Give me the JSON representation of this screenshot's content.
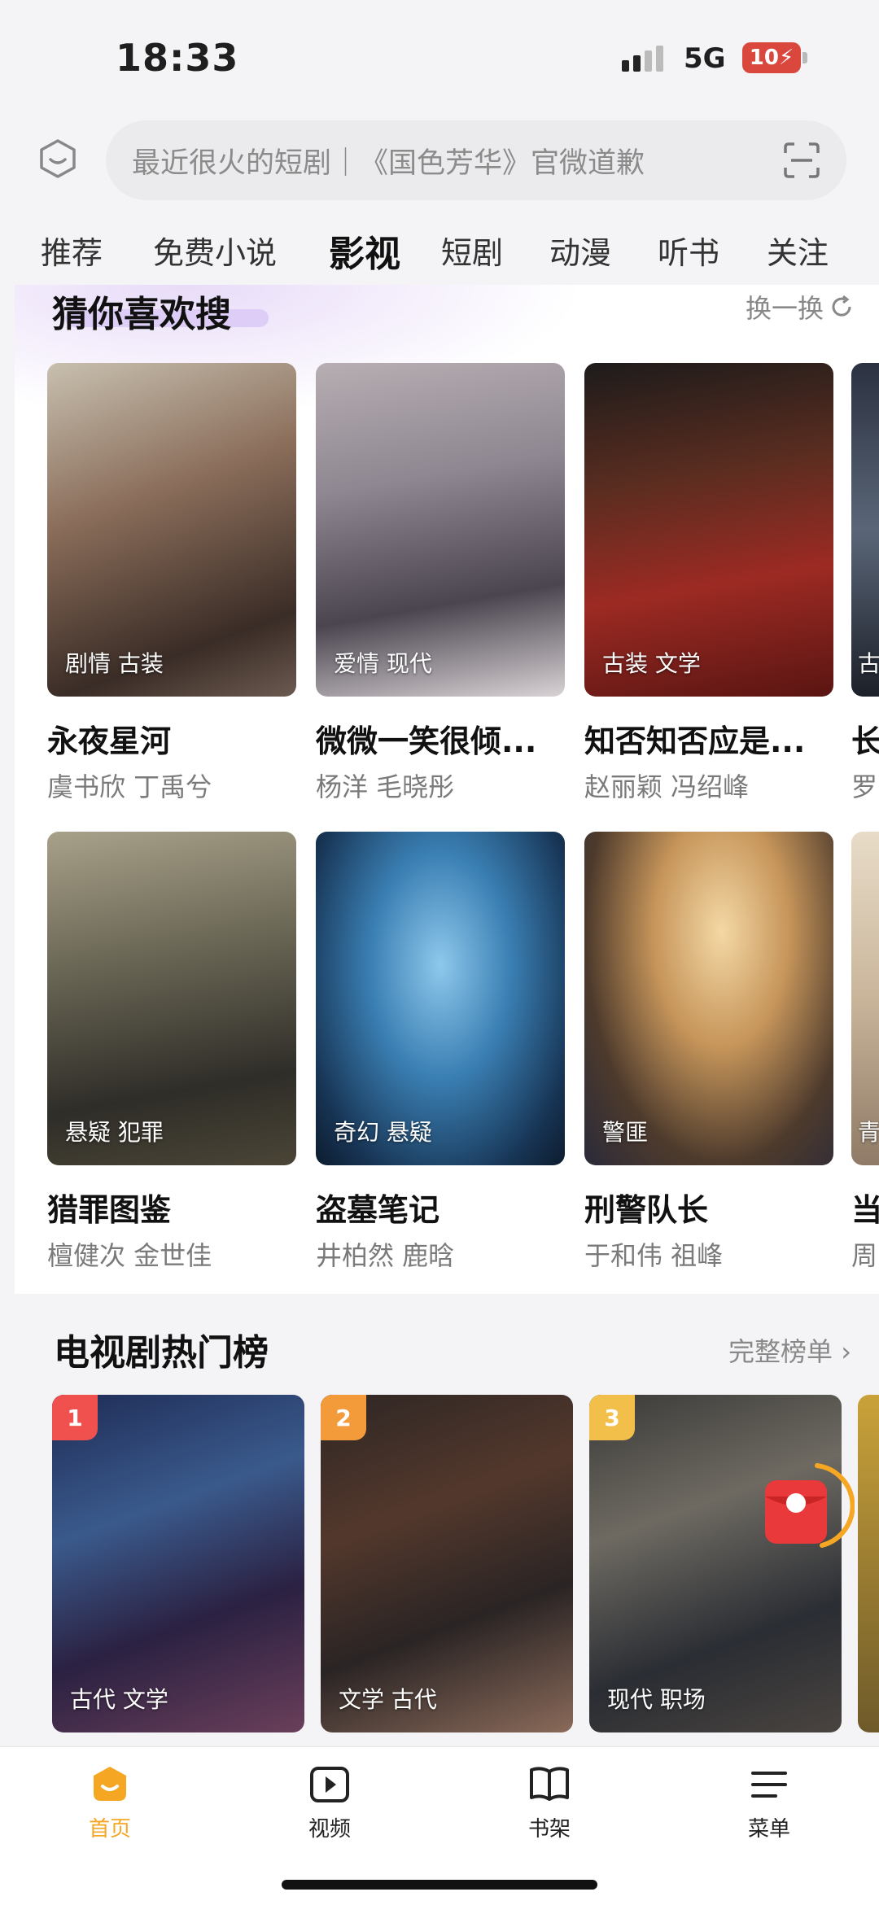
{
  "status": {
    "time": "18:33",
    "network": "5G",
    "battery": "10"
  },
  "search": {
    "placeholder": "最近很火的短剧｜《国色芳华》官微道歉"
  },
  "tabs": [
    {
      "label": "推荐"
    },
    {
      "label": "免费小说"
    },
    {
      "label": "影视"
    },
    {
      "label": "短剧"
    },
    {
      "label": "动漫"
    },
    {
      "label": "听书"
    },
    {
      "label": "关注"
    }
  ],
  "active_tab": "影视",
  "section1": {
    "title": "猜你喜欢搜",
    "refresh_label": "换一换",
    "items": [
      {
        "title": "永夜星河",
        "cast": "虞书欣 丁禹兮",
        "tags": "剧情 古装"
      },
      {
        "title": "微微一笑很倾...",
        "cast": "杨洋 毛晓彤",
        "tags": "爱情 现代"
      },
      {
        "title": "知否知否应是...",
        "cast": "赵丽颖 冯绍峰",
        "tags": "古装 文学"
      },
      {
        "title": "长",
        "cast": "罗",
        "tags": "古"
      },
      {
        "title": "猎罪图鉴",
        "cast": "檀健次 金世佳",
        "tags": "悬疑 犯罪"
      },
      {
        "title": "盗墓笔记",
        "cast": "井柏然 鹿晗",
        "tags": "奇幻 悬疑"
      },
      {
        "title": "刑警队长",
        "cast": "于和伟 祖峰",
        "tags": "警匪"
      },
      {
        "title": "当",
        "cast": "周",
        "tags": "青"
      }
    ]
  },
  "section2": {
    "title": "电视剧热门榜",
    "more_label": "完整榜单 ›",
    "items": [
      {
        "rank": "1",
        "tags": "古代 文学"
      },
      {
        "rank": "2",
        "tags": "文学 古代"
      },
      {
        "rank": "3",
        "tags": "现代 职场"
      }
    ]
  },
  "bottom_nav": [
    {
      "label": "首页"
    },
    {
      "label": "视频"
    },
    {
      "label": "书架"
    },
    {
      "label": "菜单"
    }
  ],
  "colors": {
    "accent": "#f5a623",
    "rank1": "#f0504e",
    "rank2": "#f39a3b",
    "rank3": "#f2c04a"
  }
}
